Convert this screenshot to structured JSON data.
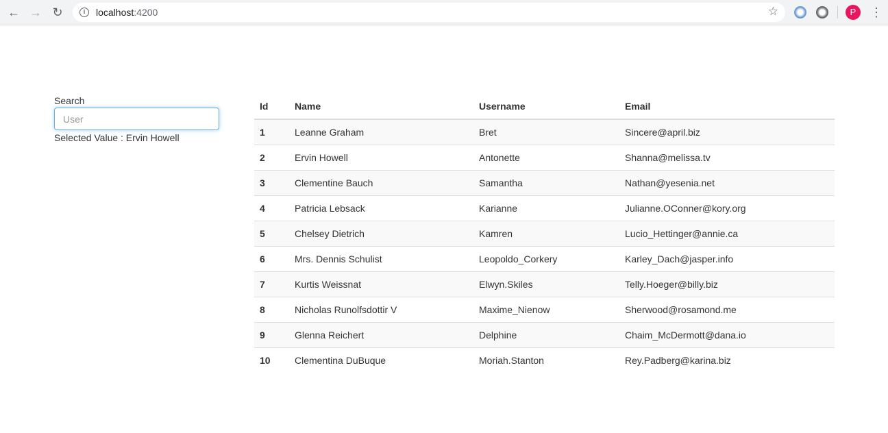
{
  "browser": {
    "url_host": "localhost",
    "url_port": ":4200",
    "profile_initial": "P"
  },
  "search": {
    "label": "Search",
    "placeholder": "User",
    "value": ""
  },
  "selected": {
    "text": "Selected Value : Ervin Howell"
  },
  "table": {
    "headers": [
      "Id",
      "Name",
      "Username",
      "Email"
    ],
    "rows": [
      [
        "1",
        "Leanne Graham",
        "Bret",
        "Sincere@april.biz"
      ],
      [
        "2",
        "Ervin Howell",
        "Antonette",
        "Shanna@melissa.tv"
      ],
      [
        "3",
        "Clementine Bauch",
        "Samantha",
        "Nathan@yesenia.net"
      ],
      [
        "4",
        "Patricia Lebsack",
        "Karianne",
        "Julianne.OConner@kory.org"
      ],
      [
        "5",
        "Chelsey Dietrich",
        "Kamren",
        "Lucio_Hettinger@annie.ca"
      ],
      [
        "6",
        "Mrs. Dennis Schulist",
        "Leopoldo_Corkery",
        "Karley_Dach@jasper.info"
      ],
      [
        "7",
        "Kurtis Weissnat",
        "Elwyn.Skiles",
        "Telly.Hoeger@billy.biz"
      ],
      [
        "8",
        "Nicholas Runolfsdottir V",
        "Maxime_Nienow",
        "Sherwood@rosamond.me"
      ],
      [
        "9",
        "Glenna Reichert",
        "Delphine",
        "Chaim_McDermott@dana.io"
      ],
      [
        "10",
        "Clementina DuBuque",
        "Moriah.Stanton",
        "Rey.Padberg@karina.biz"
      ]
    ]
  }
}
